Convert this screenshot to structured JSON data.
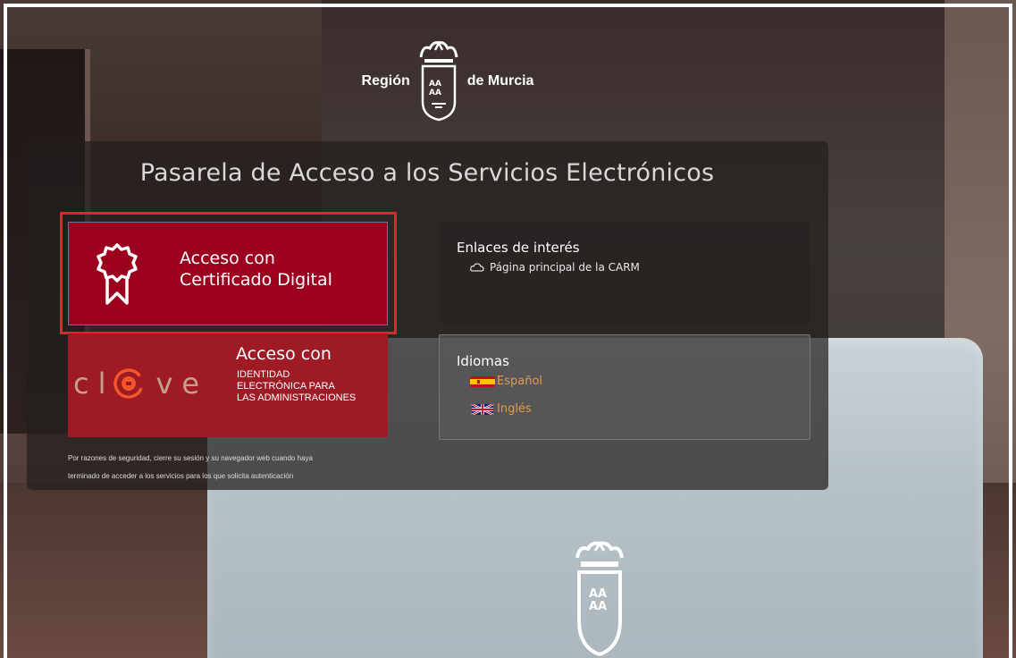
{
  "header": {
    "logo_left": "Región",
    "logo_right": "de Murcia",
    "logo_shield_icon": "murcia-coat-of-arms-icon"
  },
  "panel": {
    "title": "Pasarela de Acceso a los Servicios Electrónicos"
  },
  "certificate_button": {
    "line1": "Acceso con",
    "line2": "Certificado Digital",
    "icon": "certificate-ribbon-icon",
    "highlight_color": "#e3262d",
    "background": "#9b001f"
  },
  "clave_button": {
    "logo_text_left": "cl",
    "logo_text_right": "ve",
    "title": "Acceso con",
    "sub1": "IDENTIDAD",
    "sub2": "ELECTRÓNICA PARA",
    "sub3": "LAS ADMINISTRACIONES",
    "background": "#9e1a24"
  },
  "security_note": {
    "line1": "Por razones de seguridad, cierre su sesión y su navegador web cuando haya",
    "line2": "terminado de acceder a los servicios para los que solicita autenticación"
  },
  "links": {
    "heading": "Enlaces de interés",
    "items": [
      {
        "label": "Página principal de la CARM",
        "icon": "cloud-link-icon"
      }
    ]
  },
  "languages": {
    "heading": "Idiomas",
    "items": [
      {
        "label": "Español",
        "icon": "spain-flag-icon"
      },
      {
        "label": "Inglés",
        "icon": "uk-flag-icon"
      }
    ]
  }
}
